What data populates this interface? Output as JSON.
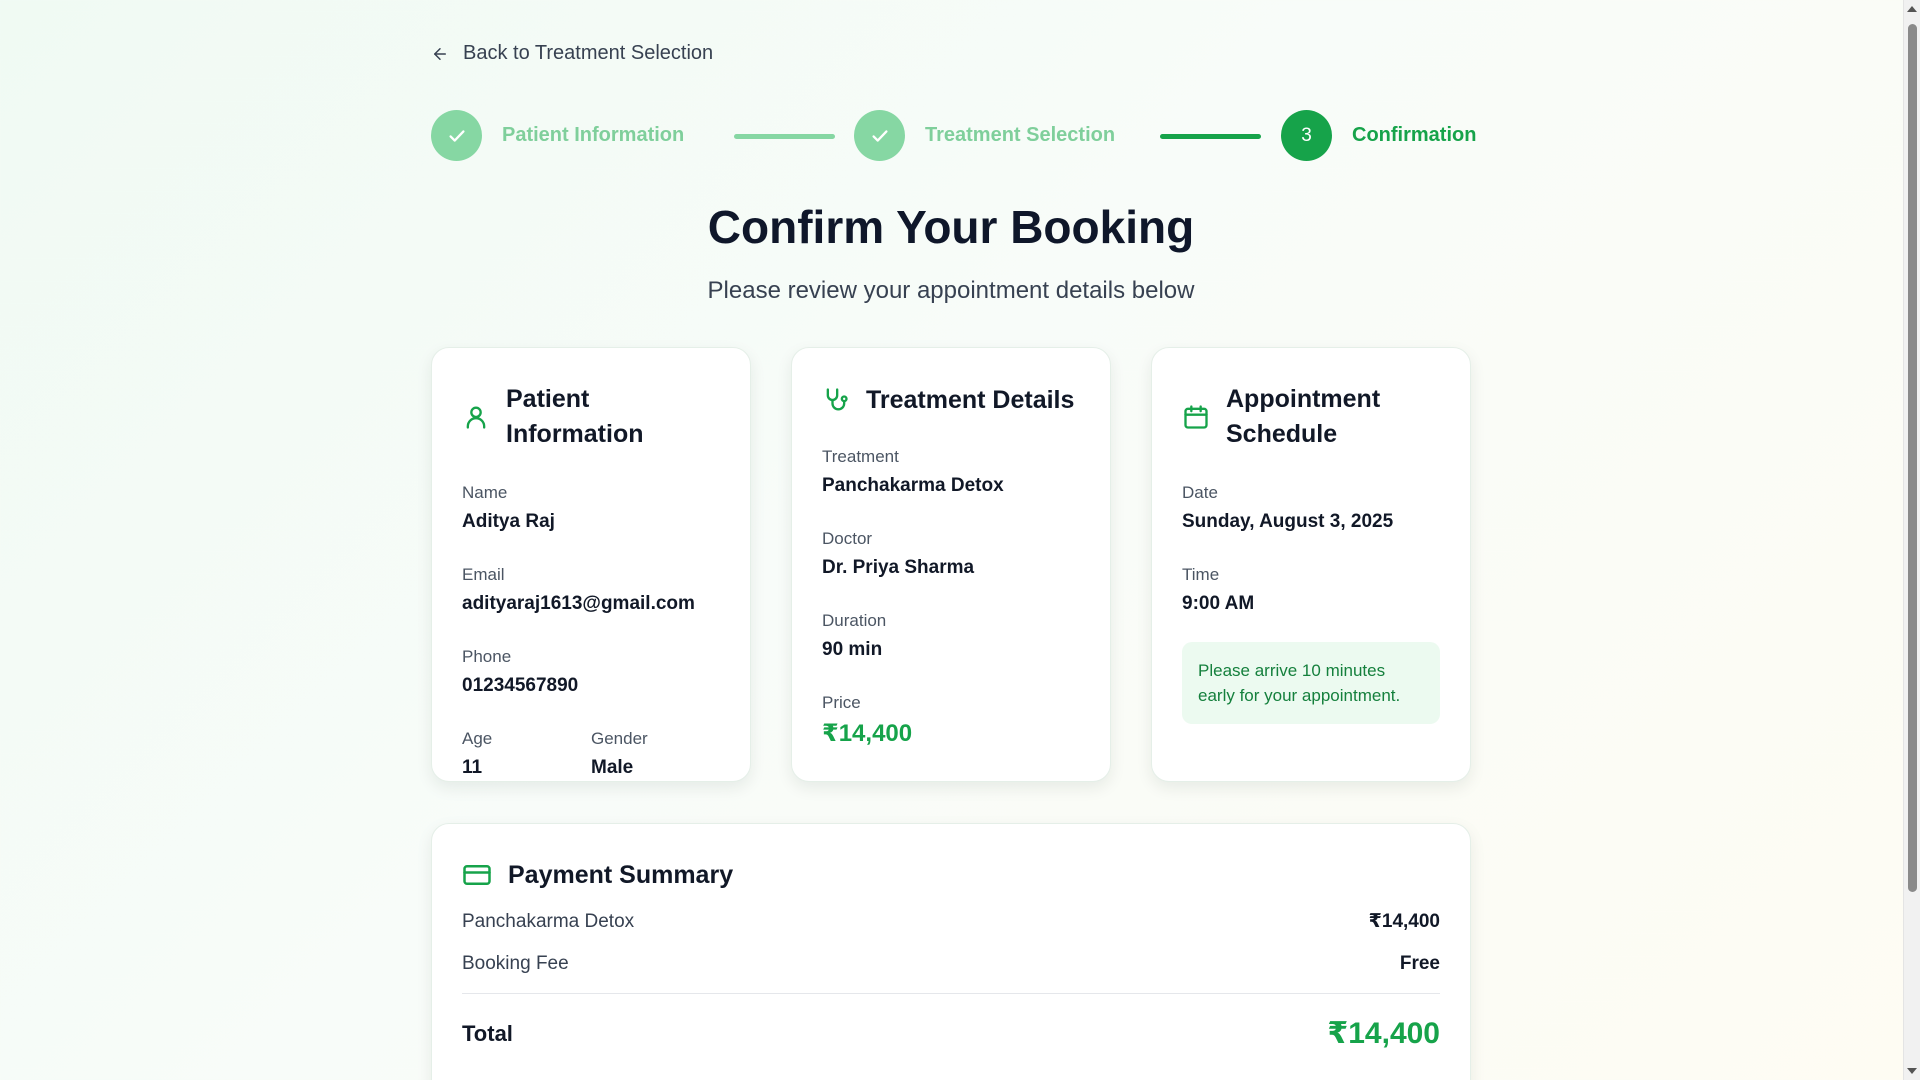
{
  "back_link": {
    "label": "Back to Treatment Selection",
    "icon": "arrow-left-icon"
  },
  "stepper": {
    "steps": [
      {
        "label": "Patient Information",
        "status": "done",
        "marker": "✓"
      },
      {
        "label": "Treatment Selection",
        "status": "done",
        "marker": "✓"
      },
      {
        "label": "Confirmation",
        "status": "active",
        "marker": "3"
      }
    ],
    "colors": {
      "done": "#86d7a3",
      "active": "#16a34a",
      "connector_done": "#86d7a3",
      "connector_active": "#16a34a"
    }
  },
  "header": {
    "title": "Confirm Your Booking",
    "subtitle": "Please review your appointment details below"
  },
  "patient_card": {
    "title": "Patient Information",
    "icon": "user-icon",
    "name_label": "Name",
    "name": "Aditya Raj",
    "email_label": "Email",
    "email": "adityaraj1613@gmail.com",
    "phone_label": "Phone",
    "phone": "01234567890",
    "age_label": "Age",
    "age": "11",
    "gender_label": "Gender",
    "gender": "Male"
  },
  "treatment_card": {
    "title": "Treatment Details",
    "icon": "stethoscope-icon",
    "treatment_label": "Treatment",
    "treatment": "Panchakarma Detox",
    "doctor_label": "Doctor",
    "doctor": "Dr. Priya Sharma",
    "duration_label": "Duration",
    "duration": "90 min",
    "price_label": "Price",
    "price": "₹14,400"
  },
  "schedule_card": {
    "title": "Appointment Schedule",
    "icon": "calendar-icon",
    "date_label": "Date",
    "date": "Sunday, August 3, 2025",
    "time_label": "Time",
    "time": "9:00 AM",
    "note": "Please arrive 10 minutes early for your appointment."
  },
  "payment": {
    "title": "Payment Summary",
    "icon": "credit-card-icon",
    "items": [
      {
        "name": "Panchakarma Detox",
        "amount": "₹14,400"
      },
      {
        "name": "Booking Fee",
        "amount": "Free"
      }
    ],
    "total_label": "Total",
    "total": "₹14,400"
  },
  "accent_color": "#16a34a"
}
